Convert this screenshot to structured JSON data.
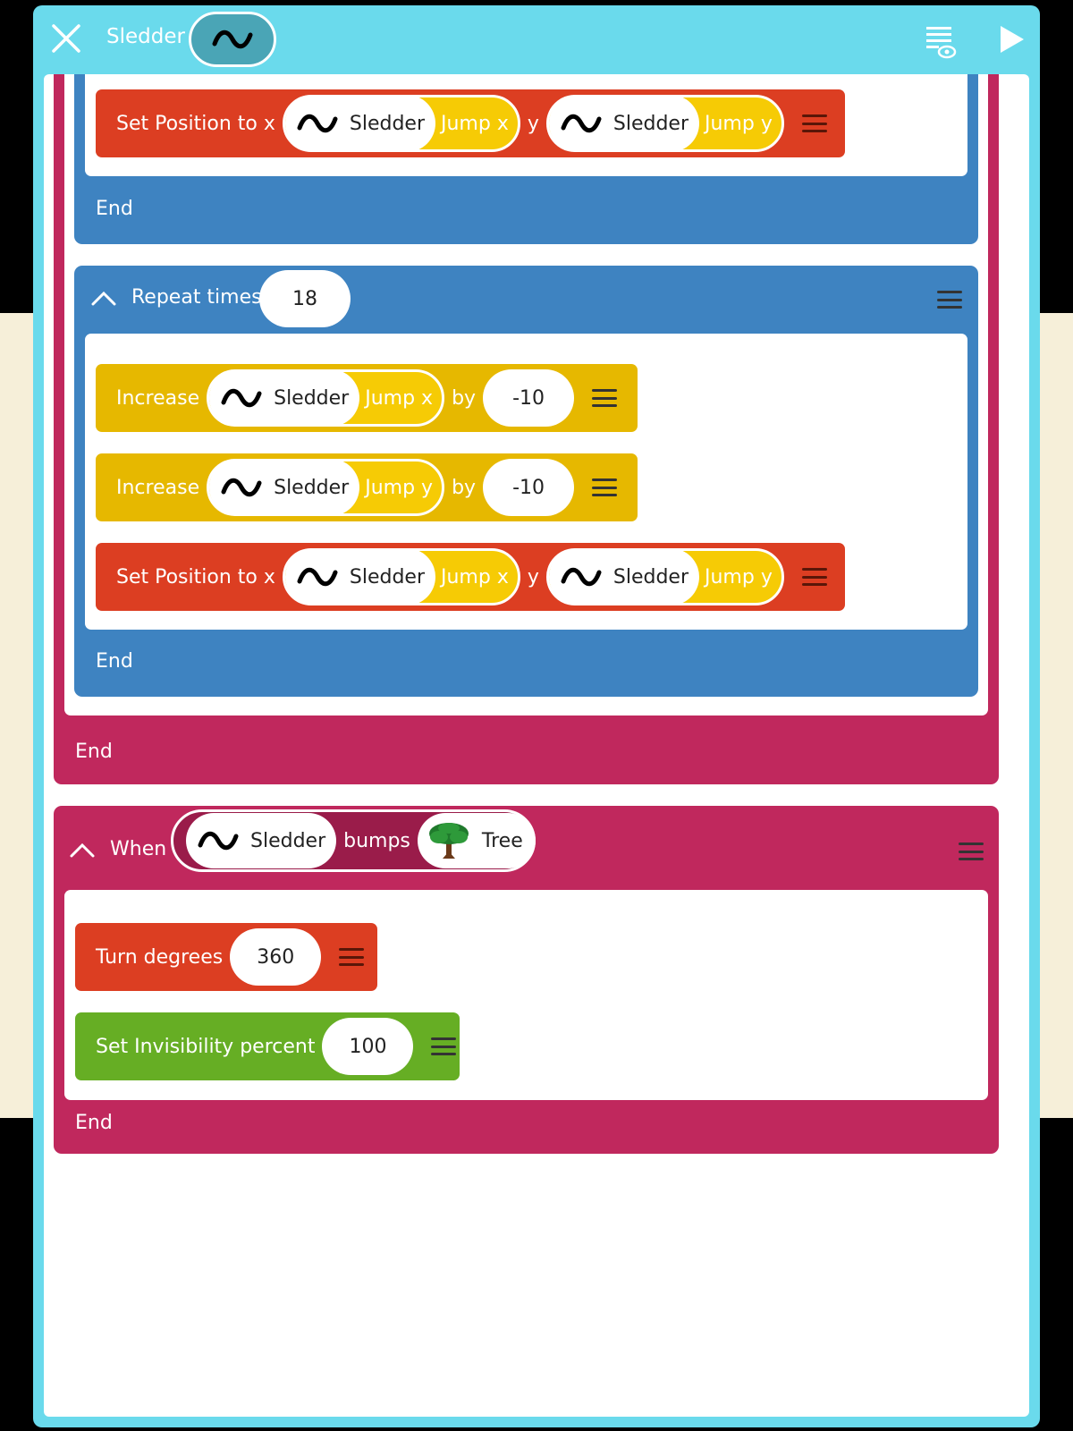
{
  "topbar": {
    "sprite_name": "Sledder",
    "close_icon": "close-icon",
    "sprite_icon": "squiggle-icon",
    "code_view_icon": "list-eye-icon",
    "play_icon": "play-icon"
  },
  "colors": {
    "frame": "#6adaec",
    "rule_pink": "#c0285d",
    "repeat_blue": "#3e83c1",
    "action_red": "#dc3e22",
    "variable_yellow": "#e6b800",
    "looks_green": "#66ae24"
  },
  "block1": {
    "set_position": {
      "label": "Set Position to x",
      "y_label": "y",
      "x_var": {
        "name": "Sledder",
        "property": "Jump x"
      },
      "y_var": {
        "name": "Sledder",
        "property": "Jump y"
      }
    },
    "end_label": "End"
  },
  "repeat": {
    "label": "Repeat times",
    "count": "18",
    "increase_x": {
      "label": "Increase",
      "by_label": "by",
      "var": {
        "name": "Sledder",
        "property": "Jump x"
      },
      "value": "-10"
    },
    "increase_y": {
      "label": "Increase",
      "by_label": "by",
      "var": {
        "name": "Sledder",
        "property": "Jump y"
      },
      "value": "-10"
    },
    "set_position": {
      "label": "Set Position to x",
      "y_label": "y",
      "x_var": {
        "name": "Sledder",
        "property": "Jump x"
      },
      "y_var": {
        "name": "Sledder",
        "property": "Jump y"
      }
    },
    "end_label": "End"
  },
  "outer_end_label": "End",
  "when_rule": {
    "label": "When",
    "subject": "Sledder",
    "verb": "bumps",
    "object": "Tree",
    "object_icon": "tree-icon",
    "turn": {
      "label": "Turn degrees",
      "value": "360"
    },
    "invisibility": {
      "label": "Set Invisibility percent",
      "value": "100"
    },
    "end_label": "End"
  }
}
